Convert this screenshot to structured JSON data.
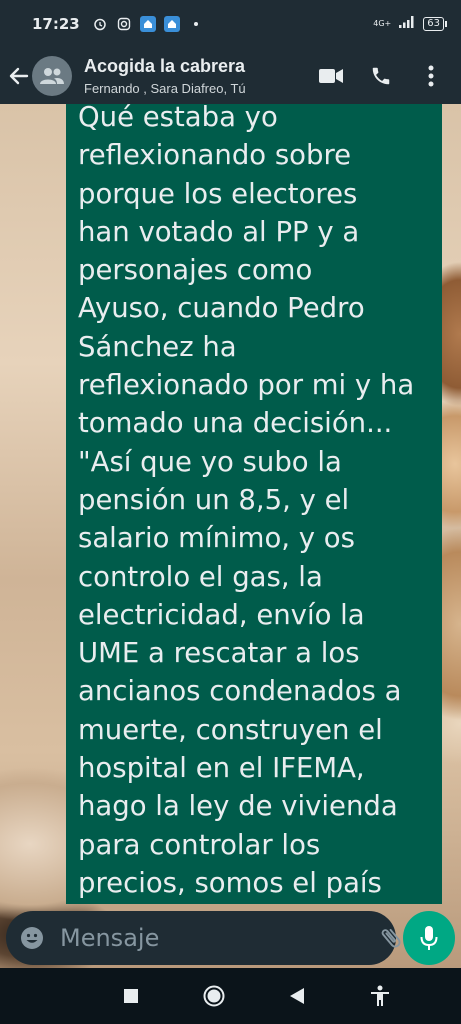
{
  "status_bar": {
    "time": "17:23",
    "network": "4G+",
    "battery": "63"
  },
  "header": {
    "title": "Acogida la cabrera",
    "subtitle": "Fernando , Sara Diafreo, Tú"
  },
  "message": {
    "text": "Qué estaba yo\nreflexionando sobre\nporque los electores\nhan votado al PP y a\npersonajes como\nAyuso, cuando Pedro\nSánchez ha\nreflexionado por mi y ha\ntomado una decisión...\n\"Así que yo subo la\npensión un 8,5, y el\nsalario mínimo, y os\ncontrolo el gas, la\nelectricidad, envío la\nUME a rescatar a los\nancianos condenados a\nmuerte, construyen el\nhospital en el IFEMA,\nhago la ley de vivienda\npara controlar los\nprecios, somos el país"
  },
  "composer": {
    "placeholder": "Mensaje"
  },
  "colors": {
    "header_bg": "#1f2c34",
    "bubble_bg": "#005c4b",
    "accent": "#00a884"
  },
  "icons": {
    "back": "back-arrow-icon",
    "avatar": "group-icon",
    "video": "video-call-icon",
    "call": "phone-icon",
    "menu": "more-vert-icon",
    "emoji": "emoji-icon",
    "attach": "paperclip-icon",
    "camera": "camera-icon",
    "mic": "microphone-icon"
  }
}
